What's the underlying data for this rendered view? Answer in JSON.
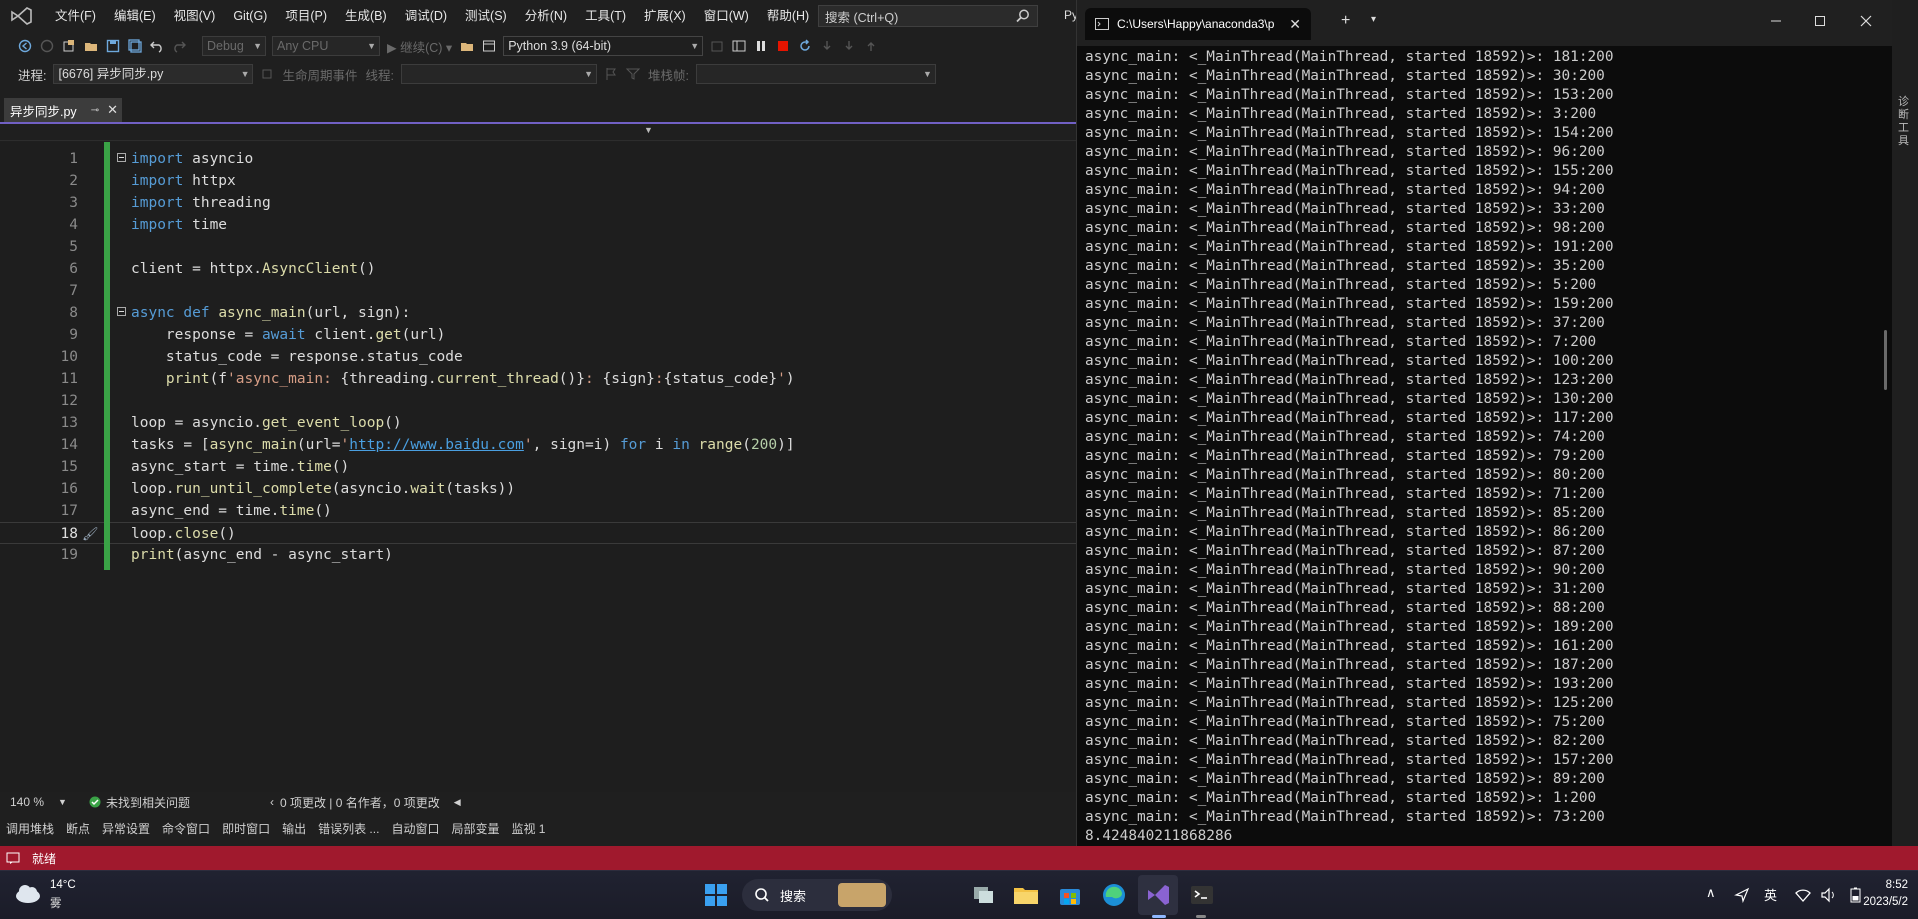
{
  "menu": [
    "文件(F)",
    "编辑(E)",
    "视图(V)",
    "Git(G)",
    "项目(P)",
    "生成(B)",
    "调试(D)",
    "测试(S)",
    "分析(N)",
    "工具(T)",
    "扩展(X)",
    "窗口(W)",
    "帮助(H)"
  ],
  "search": {
    "label": "搜索 (Ctrl+Q)"
  },
  "toolbar": {
    "config": "Debug",
    "platform": "Any CPU",
    "continue": "继续(C)",
    "python_env": "Python 3.9 (64-bit)"
  },
  "debugbar": {
    "process_label": "进程:",
    "process_value": "[6676] 异步同步.py",
    "lifecycle_label": "生命周期事件",
    "thread_label": "线程:",
    "stackframe_label": "堆栈帧:"
  },
  "editor_tab": {
    "title": "异步同步.py",
    "pin": "⊸",
    "close": "✕"
  },
  "code_lines": [
    {
      "n": "1",
      "html": "<span class='kw'>import</span> asyncio"
    },
    {
      "n": "2",
      "html": "<span class='kw'>import</span> httpx"
    },
    {
      "n": "3",
      "html": "<span class='kw'>import</span> threading"
    },
    {
      "n": "4",
      "html": "<span class='kw'>import</span> time"
    },
    {
      "n": "5",
      "html": ""
    },
    {
      "n": "6",
      "html": "client = httpx.<span class='fn'>AsyncClient</span>()"
    },
    {
      "n": "7",
      "html": ""
    },
    {
      "n": "8",
      "html": "<span class='kw'>async def</span> <span class='fn'>async_main</span>(url, sign):"
    },
    {
      "n": "9",
      "html": "    response = <span class='kw'>await</span> client.<span class='fn'>get</span>(url)"
    },
    {
      "n": "10",
      "html": "    status_code = response.status_code"
    },
    {
      "n": "11",
      "html": "    <span class='fn'>print</span>(f<span class='str'>'async_main: </span>{threading.<span class='fn'>current_thread</span>()}<span class='str'>: </span>{sign}<span class='str'>:</span>{status_code}<span class='str'>'</span>)"
    },
    {
      "n": "12",
      "html": ""
    },
    {
      "n": "13",
      "html": "loop = asyncio.<span class='fn'>get_event_loop</span>()"
    },
    {
      "n": "14",
      "html": "tasks = [<span class='fn'>async_main</span>(url=<span class='str'>'</span><span class='url'>http://www.baidu.com</span><span class='str'>'</span>, sign=i) <span class='kw'>for</span> i <span class='kw'>in</span> <span class='fn'>range</span>(<span class='num'>200</span>)]"
    },
    {
      "n": "15",
      "html": "async_start = time.<span class='fn'>time</span>()"
    },
    {
      "n": "16",
      "html": "loop.<span class='fn'>run_until_complete</span>(asyncio.<span class='fn'>wait</span>(tasks))"
    },
    {
      "n": "17",
      "html": "async_end = time.<span class='fn'>time</span>()"
    },
    {
      "n": "18",
      "html": "loop.<span class='fn'>close</span>()"
    },
    {
      "n": "19",
      "html": "<span class='fn'>print</span>(async_end - async_start)"
    }
  ],
  "editor_status": {
    "zoom": "140 %",
    "issues": "未找到相关问题",
    "changes": "0 项更改 | 0 名作者，0 项更改"
  },
  "tool_windows": [
    "调用堆栈",
    "断点",
    "异常设置",
    "命令窗口",
    "即时窗口",
    "输出",
    "错误列表 ...",
    "自动窗口",
    "局部变量",
    "监视 1"
  ],
  "status": {
    "ready": "就绪"
  },
  "terminal": {
    "tab_title": "C:\\Users\\Happy\\anaconda3\\p",
    "prefix": "async_main: <_MainThread(MainThread, started 18592)>: ",
    "signs": [
      "181",
      "30",
      "153",
      "3",
      "154",
      "96",
      "155",
      "94",
      "33",
      "98",
      "191",
      "35",
      "5",
      "159",
      "37",
      "7",
      "100",
      "123",
      "130",
      "117",
      "74",
      "79",
      "80",
      "71",
      "85",
      "86",
      "87",
      "90",
      "31",
      "88",
      "189",
      "161",
      "187",
      "193",
      "125",
      "75",
      "82",
      "157",
      "89",
      "1",
      "73"
    ],
    "suffix": ":200",
    "elapsed": "8.424840211868286"
  },
  "taskbar": {
    "temp": "14°C",
    "weather": "雾",
    "search": "搜索",
    "ime": "英",
    "time": "8:52",
    "date": "2023/5/2"
  },
  "sidebar_right": "诊断工具"
}
